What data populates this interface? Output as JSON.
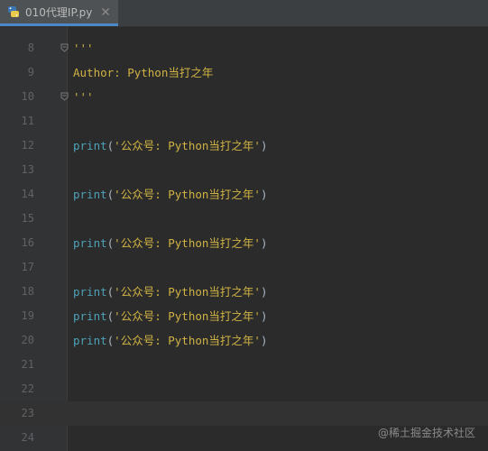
{
  "tab": {
    "filename": "010代理IP.py"
  },
  "lines": [
    {
      "number": "8",
      "parts": [
        {
          "cls": "doc",
          "text": "'''"
        }
      ],
      "fold": true
    },
    {
      "number": "9",
      "parts": [
        {
          "cls": "doc",
          "text": "Author: Python当打之年"
        }
      ],
      "fold": false
    },
    {
      "number": "10",
      "parts": [
        {
          "cls": "doc",
          "text": "'''"
        }
      ],
      "fold": true
    },
    {
      "number": "11",
      "parts": [],
      "fold": false
    },
    {
      "number": "12",
      "parts": [
        {
          "cls": "fn",
          "text": "print"
        },
        {
          "cls": "plain",
          "text": "("
        },
        {
          "cls": "str",
          "text": "'公众号: Python当打之年'"
        },
        {
          "cls": "plain",
          "text": ")"
        }
      ],
      "fold": false
    },
    {
      "number": "13",
      "parts": [],
      "fold": false
    },
    {
      "number": "14",
      "parts": [
        {
          "cls": "fn",
          "text": "print"
        },
        {
          "cls": "plain",
          "text": "("
        },
        {
          "cls": "str",
          "text": "'公众号: Python当打之年'"
        },
        {
          "cls": "plain",
          "text": ")"
        }
      ],
      "fold": false
    },
    {
      "number": "15",
      "parts": [],
      "fold": false
    },
    {
      "number": "16",
      "parts": [
        {
          "cls": "fn",
          "text": "print"
        },
        {
          "cls": "plain",
          "text": "("
        },
        {
          "cls": "str",
          "text": "'公众号: Python当打之年'"
        },
        {
          "cls": "plain",
          "text": ")"
        }
      ],
      "fold": false
    },
    {
      "number": "17",
      "parts": [],
      "fold": false
    },
    {
      "number": "18",
      "parts": [
        {
          "cls": "fn",
          "text": "print"
        },
        {
          "cls": "plain",
          "text": "("
        },
        {
          "cls": "str",
          "text": "'公众号: Python当打之年'"
        },
        {
          "cls": "plain",
          "text": ")"
        }
      ],
      "fold": false
    },
    {
      "number": "19",
      "parts": [
        {
          "cls": "fn",
          "text": "print"
        },
        {
          "cls": "plain",
          "text": "("
        },
        {
          "cls": "str",
          "text": "'公众号: Python当打之年'"
        },
        {
          "cls": "plain",
          "text": ")"
        }
      ],
      "fold": false
    },
    {
      "number": "20",
      "parts": [
        {
          "cls": "fn",
          "text": "print"
        },
        {
          "cls": "plain",
          "text": "("
        },
        {
          "cls": "str",
          "text": "'公众号: Python当打之年'"
        },
        {
          "cls": "plain",
          "text": ")"
        }
      ],
      "fold": false
    },
    {
      "number": "21",
      "parts": [],
      "fold": false
    },
    {
      "number": "22",
      "parts": [],
      "fold": false
    },
    {
      "number": "23",
      "parts": [],
      "fold": false,
      "current": true
    },
    {
      "number": "24",
      "parts": [],
      "fold": false
    }
  ],
  "watermark": "@稀土掘金技术社区",
  "colors": {
    "background": "#2b2b2b",
    "gutter": "#313335",
    "string": "#d0b344",
    "function": "#4ea1b8",
    "line_number": "#606366",
    "current_line": "#323232",
    "tab_active_underline": "#4a88c7"
  }
}
